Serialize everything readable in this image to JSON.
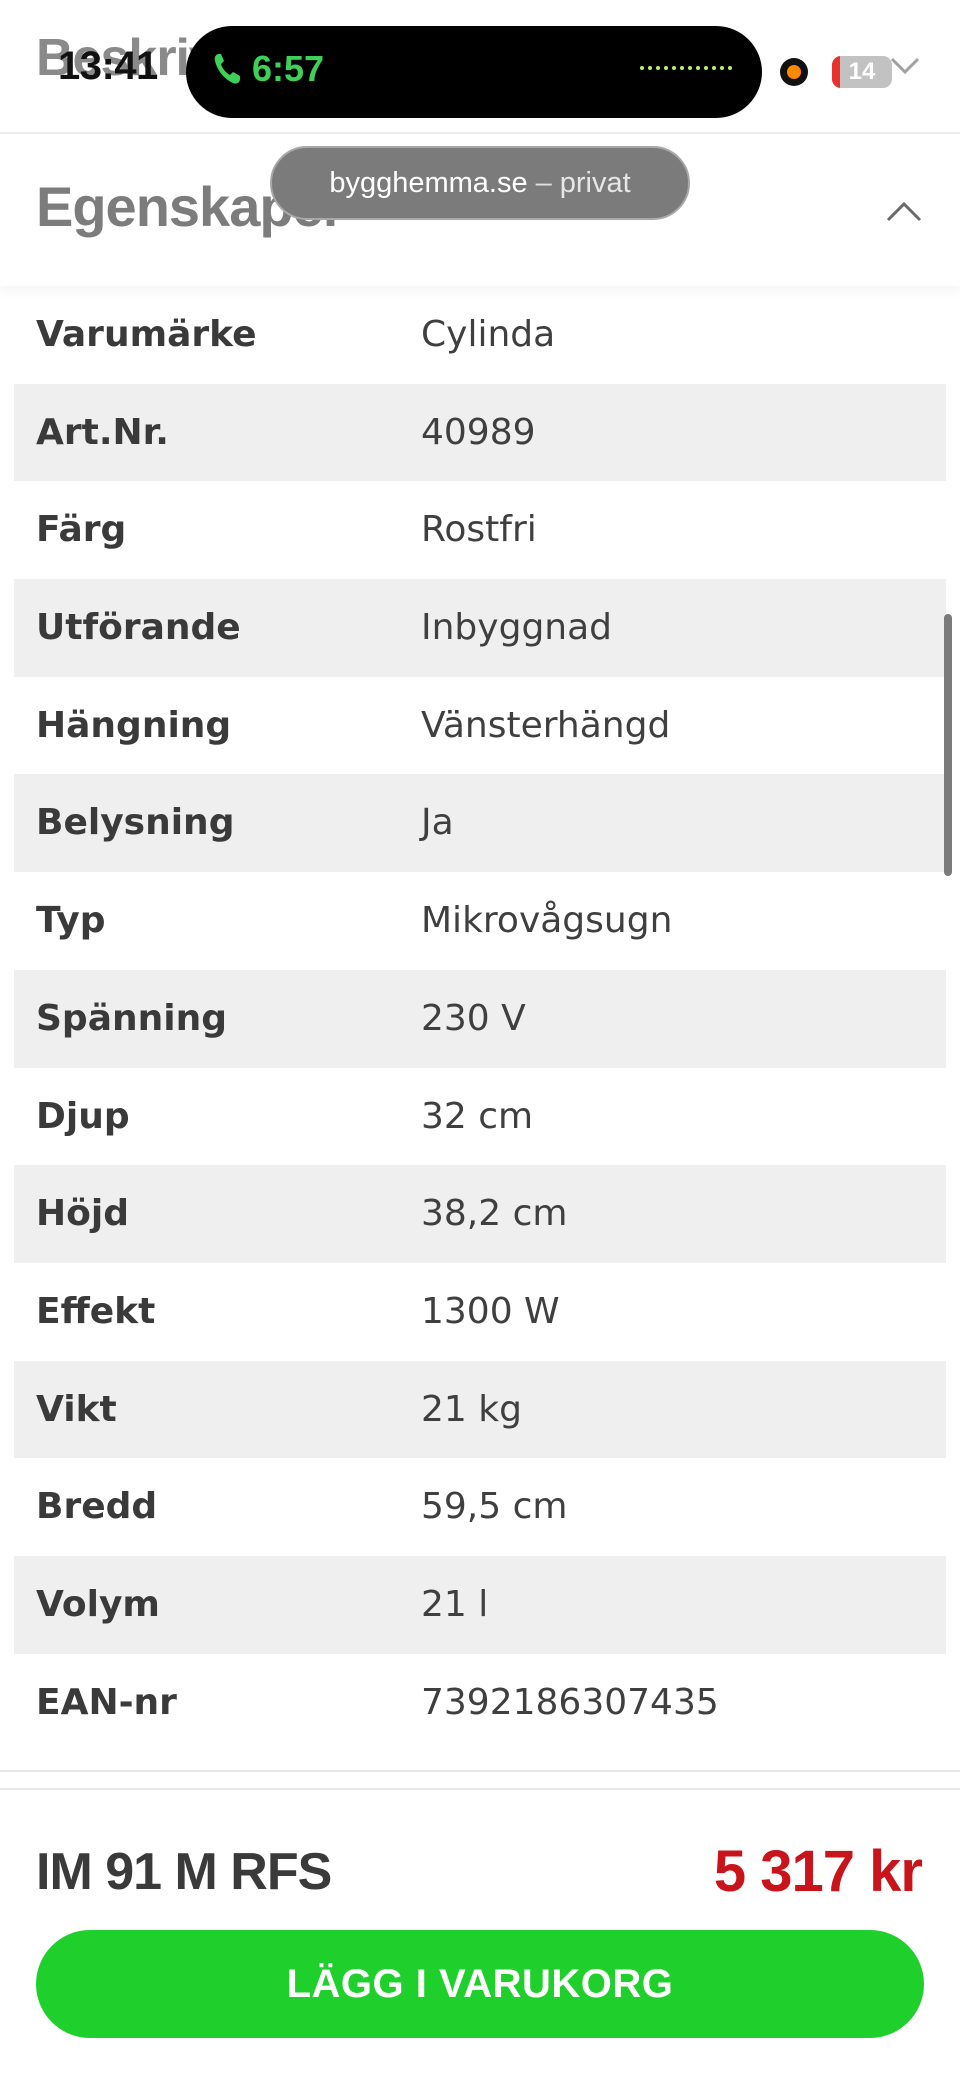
{
  "status_bar": {
    "time": "13:41",
    "call_time": "6:57",
    "battery": "14",
    "battery_level_percent": 14,
    "icons": [
      "phone-icon",
      "recording-dot-icon",
      "battery-icon"
    ]
  },
  "browser": {
    "host": "bygghemma.se",
    "separator": "–",
    "mode": "privat"
  },
  "sections": {
    "description_title": "Beskrivning",
    "properties_title": "Egenskaper"
  },
  "specs": [
    {
      "key": "Varumärke",
      "value": "Cylinda"
    },
    {
      "key": "Art.Nr.",
      "value": "40989"
    },
    {
      "key": "Färg",
      "value": "Rostfri"
    },
    {
      "key": "Utförande",
      "value": "Inbyggnad"
    },
    {
      "key": "Hängning",
      "value": "Vänsterhängd"
    },
    {
      "key": "Belysning",
      "value": "Ja"
    },
    {
      "key": "Typ",
      "value": "Mikrovågsugn"
    },
    {
      "key": "Spänning",
      "value": "230 V"
    },
    {
      "key": "Djup",
      "value": "32 cm"
    },
    {
      "key": "Höjd",
      "value": "38,2 cm"
    },
    {
      "key": "Effekt",
      "value": "1300 W"
    },
    {
      "key": "Vikt",
      "value": "21 kg"
    },
    {
      "key": "Bredd",
      "value": "59,5 cm"
    },
    {
      "key": "Volym",
      "value": "21 l"
    },
    {
      "key": "EAN-nr",
      "value": "7392186307435"
    }
  ],
  "purchase": {
    "product_name": "IM 91 M RFS",
    "price": "5 317 kr",
    "add_to_cart_label": "LÄGG I VARUKORG"
  },
  "colors": {
    "accent_green": "#1fcf2b",
    "price_red": "#c8151b",
    "row_alt": "#efefef"
  }
}
